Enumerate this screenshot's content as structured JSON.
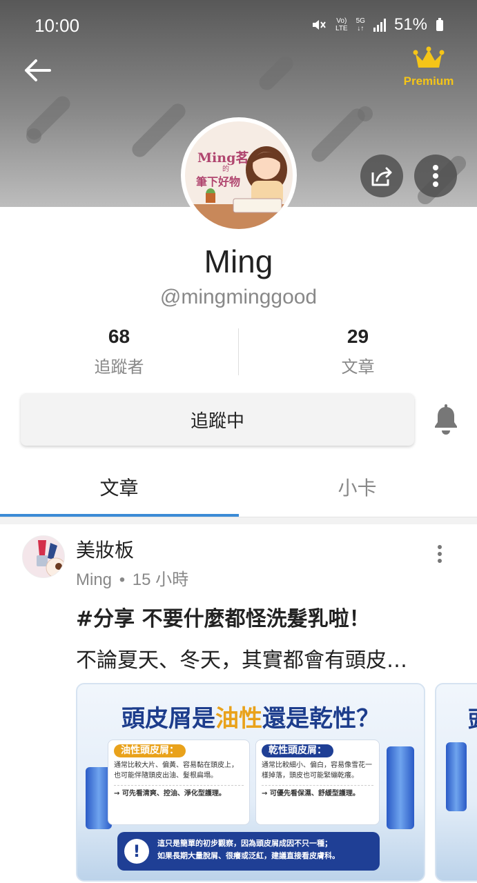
{
  "status_bar": {
    "time": "10:00",
    "network_top": "Vo)",
    "network_bottom": "LTE",
    "network_5g": "5G",
    "battery": "51%"
  },
  "header": {
    "premium_label": "Premium"
  },
  "profile": {
    "avatar_text_line1": "Ming茗",
    "avatar_text_line2": "筆下好物",
    "avatar_text_small": "的",
    "name": "Ming",
    "handle": "@mingminggood",
    "followers_count": "68",
    "followers_label": "追蹤者",
    "articles_count": "29",
    "articles_label": "文章",
    "follow_button_label": "追蹤中"
  },
  "tabs": [
    {
      "label": "文章",
      "active": true
    },
    {
      "label": "小卡",
      "active": false
    }
  ],
  "post": {
    "board": "美妝板",
    "author": "Ming",
    "time_ago": "15 小時",
    "title": "#分享 不要什麼都怪洗髮乳啦！",
    "excerpt": "不論夏天、冬天，其實都會有頭皮…",
    "card": {
      "heading_part1": "頭皮屑是",
      "heading_highlight": "油性",
      "heading_part2": "還是乾性？",
      "oily_title": "油性頭皮屑：",
      "oily_body": "通常比較大片、偏黃、容易黏在頭皮上，也可能伴隨頭皮出油、髮根扁塌。",
      "oily_cta": "→ 可先看清爽、控油、淨化型護理。",
      "dry_title": "乾性頭皮屑：",
      "dry_body": "通常比較細小、偏白，容易像雪花一樣掉落，頭皮也可能緊繃乾癢。",
      "dry_cta": "→ 可優先看保濕、舒緩型護理。",
      "note_line1": "這只是簡單的初步觀察，因為頭皮屑成因不只一種；",
      "note_line2": "如果長期大量脫屑、很癢或泛紅，建議直接看皮膚科。",
      "note_icon": "!",
      "peek_text": "頭"
    }
  },
  "colors": {
    "tab_accent": "#3b8bd6",
    "premium_gold": "#f5c518",
    "card_navy": "#1d3d8c",
    "card_highlight": "#e9a21b"
  },
  "icons": {
    "back": "arrow-left-icon",
    "premium": "crown-icon",
    "share": "share-icon",
    "more": "more-vertical-icon",
    "bell": "bell-icon"
  }
}
